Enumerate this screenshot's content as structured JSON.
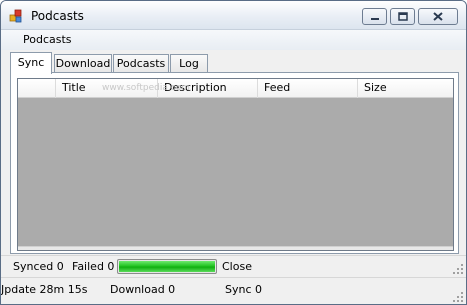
{
  "window": {
    "title": "Podcasts",
    "icon": "app-icon",
    "controls": [
      "minimize-icon",
      "maximize-icon",
      "close-icon"
    ]
  },
  "menubar": {
    "items": [
      {
        "label": "Podcasts"
      }
    ]
  },
  "tabs": [
    {
      "label": "Sync",
      "active": true
    },
    {
      "label": "Download",
      "active": false
    },
    {
      "label": "Podcasts",
      "active": false
    },
    {
      "label": "Log",
      "active": false
    }
  ],
  "grid": {
    "columns": [
      "",
      "Title",
      "Description",
      "Feed",
      "Size"
    ],
    "rows": [],
    "watermark": "www.softpedia.com"
  },
  "status_top": {
    "synced": "Synced 0",
    "failed": "Failed 0",
    "progress": 1.0,
    "progress_color": "#1fbe1f",
    "close_label": "Close"
  },
  "status_bottom": {
    "update": "Jpdate 28m 15s",
    "download": "Download 0",
    "sync": "Sync 0"
  },
  "colors": {
    "grid_background": "#ababab",
    "window_background": "#f0f0f0"
  }
}
